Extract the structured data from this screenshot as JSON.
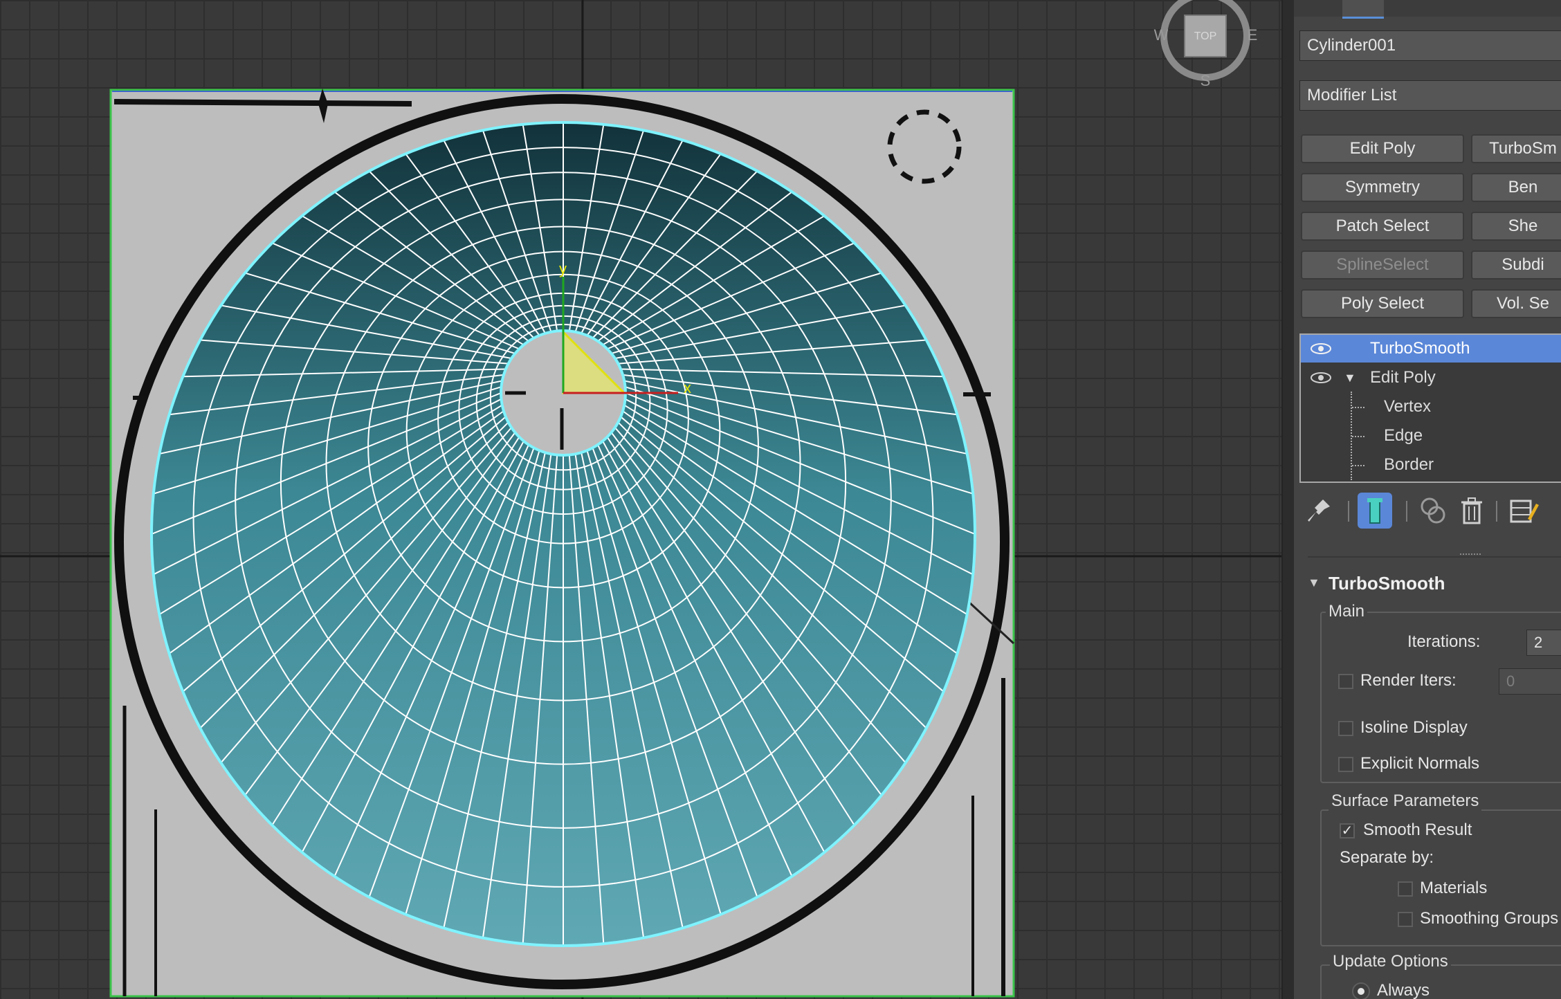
{
  "viewcube": {
    "west": "W",
    "east": "E",
    "south": "S",
    "face": "TOP"
  },
  "gizmo": {
    "y_label": "y",
    "x_label": "x"
  },
  "panel": {
    "object_name": "Cylinder001",
    "modifier_list": "Modifier List",
    "modifier_buttons": [
      "Edit Poly",
      "TurboSm",
      "Symmetry",
      "Ben",
      "Patch Select",
      "She",
      "SplineSelect",
      "Subdi",
      "Poly Select",
      "Vol. Se"
    ],
    "stack": [
      {
        "label": "TurboSmooth",
        "selected": true
      },
      {
        "label": "Edit Poly",
        "expanded": true
      },
      {
        "label": "Vertex"
      },
      {
        "label": "Edge"
      },
      {
        "label": "Border"
      }
    ],
    "turbosmooth": {
      "title": "TurboSmooth",
      "main": {
        "label": "Main",
        "iterations_label": "Iterations:",
        "iterations_value": "2",
        "render_iters_label": "Render Iters:",
        "render_iters_value": "0",
        "render_iters_checked": false,
        "isoline_label": "Isoline Display",
        "isoline_checked": false,
        "explicit_normals_label": "Explicit Normals",
        "explicit_normals_checked": false
      },
      "surface": {
        "label": "Surface Parameters",
        "smooth_result_label": "Smooth Result",
        "smooth_result_checked": true,
        "separate_by_label": "Separate by:",
        "materials_label": "Materials",
        "materials_checked": false,
        "smoothing_groups_label": "Smoothing Groups",
        "smoothing_groups_checked": false
      },
      "update": {
        "label": "Update Options",
        "always_label": "Always"
      }
    }
  },
  "colors": {
    "selection_blue": "#5b87d8",
    "mesh_teal": "#4f9aa6",
    "wire": "#ffffff",
    "selection_outline": "#7ff3ff"
  }
}
